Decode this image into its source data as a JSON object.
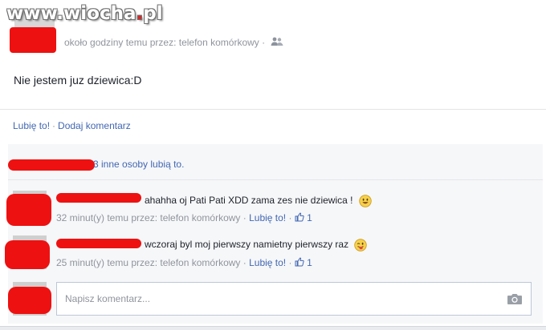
{
  "watermark": {
    "prefix": "www.",
    "name": "wiocha",
    "dot": ".",
    "suffix": "pl"
  },
  "post": {
    "meta": "około godziny temu przez: telefon komórkowy ·",
    "text": "Nie jestem juz dziewica:D",
    "privacy_icon": "friends-icon"
  },
  "actions": {
    "like": "Lubię to!",
    "separator": "·",
    "comment": "Dodaj komentarz"
  },
  "likes": {
    "text": "3 inne osoby lubią to."
  },
  "comments": [
    {
      "text": "ahahha oj Pati Pati XDD zama zes nie dziewica !",
      "time": "32 minut(y) temu przez: telefon komórkowy ·",
      "like_label": "Lubię to!",
      "like_count": "1",
      "emoji": "smile-emoji"
    },
    {
      "text": "wczoraj byl moj pierwszy namietny pierwszy raz",
      "time": "25 minut(y) temu przez: telefon komórkowy ·",
      "like_label": "Lubię to!",
      "like_count": "1",
      "emoji": "tongue-emoji"
    }
  ],
  "composer": {
    "placeholder": "Napisz komentarz...",
    "camera_icon": "camera-icon"
  },
  "colors": {
    "link": "#4267b2",
    "meta": "#90949c",
    "redaction": "#ee1111",
    "ufi_bg": "#f6f7f9"
  }
}
